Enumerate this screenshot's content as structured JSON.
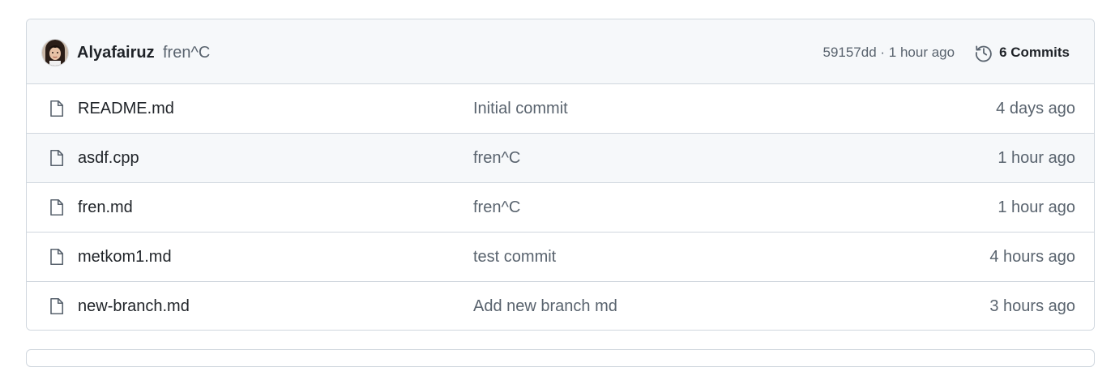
{
  "latest_commit": {
    "author": "Alyafairuz",
    "message": "fren^C",
    "sha_time": "59157dd · 1 hour ago",
    "commits_label": "6 Commits"
  },
  "files": [
    {
      "name": "README.md",
      "message": "Initial commit",
      "age": "4 days ago",
      "icon": "file-icon"
    },
    {
      "name": "asdf.cpp",
      "message": "fren^C",
      "age": "1 hour ago",
      "icon": "file-icon"
    },
    {
      "name": "fren.md",
      "message": "fren^C",
      "age": "1 hour ago",
      "icon": "file-icon"
    },
    {
      "name": "metkom1.md",
      "message": "test commit",
      "age": "4 hours ago",
      "icon": "file-icon"
    },
    {
      "name": "new-branch.md",
      "message": "Add new branch md",
      "age": "3 hours ago",
      "icon": "file-icon"
    }
  ],
  "colors": {
    "header_bg": "#f6f8fa",
    "border": "#d0d7de",
    "text": "#1f2328",
    "muted": "#59636e"
  }
}
